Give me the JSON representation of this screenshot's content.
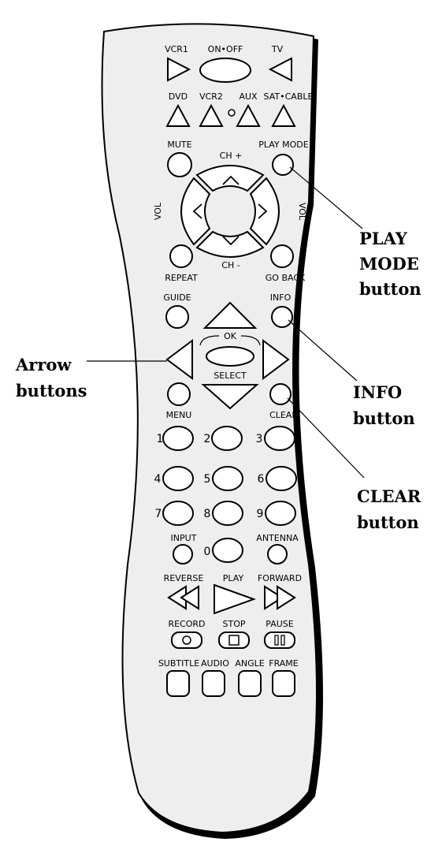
{
  "remote": {
    "labels": {
      "vcr1": "VCR1",
      "on_off": "ON•OFF",
      "tv": "TV",
      "dvd": "DVD",
      "vcr2": "VCR2",
      "aux": "AUX",
      "sat_cable": "SAT•CABLE",
      "mute": "MUTE",
      "play_mode": "PLAY MODE",
      "ch_plus": "CH +",
      "ch_minus": "CH -",
      "vol_left": "VOL",
      "vol_right": "VOL",
      "repeat": "REPEAT",
      "go_back": "GO BACK",
      "guide": "GUIDE",
      "info": "INFO",
      "ok": "OK",
      "select": "SELECT",
      "menu": "MENU",
      "clear": "CLEAR",
      "input": "INPUT",
      "antenna": "ANTENNA",
      "reverse": "REVERSE",
      "play": "PLAY",
      "forward": "FORWARD",
      "record": "RECORD",
      "stop": "STOP",
      "pause": "PAUSE",
      "subtitle": "SUBTITLE",
      "audio": "AUDIO",
      "angle": "ANGLE",
      "frame": "FRAME"
    },
    "digits": [
      "1",
      "2",
      "3",
      "4",
      "5",
      "6",
      "7",
      "8",
      "9",
      "0"
    ]
  },
  "callouts": {
    "play_mode": [
      "PLAY",
      "MODE",
      "button"
    ],
    "arrow": [
      "Arrow",
      "buttons"
    ],
    "info": [
      "INFO",
      "button"
    ],
    "clear": [
      "CLEAR",
      "button"
    ]
  }
}
